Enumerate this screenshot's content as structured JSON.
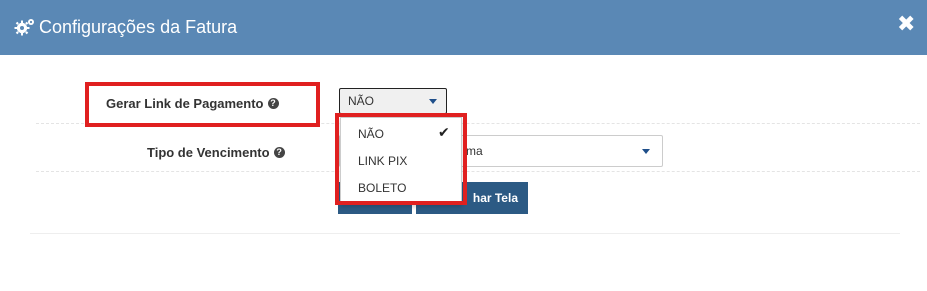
{
  "modal": {
    "title": "Configurações da Fatura",
    "close_glyph": "✖"
  },
  "form": {
    "payment_link": {
      "label": "Gerar Link de Pagamento",
      "help_glyph": "?",
      "selected": "NÃO",
      "options": [
        "NÃO",
        "LINK PIX",
        "BOLETO"
      ],
      "checkmark": "✔"
    },
    "due_type": {
      "label": "Tipo de Vencimento",
      "help_glyph": "?",
      "visible_value": "ma"
    }
  },
  "buttons": {
    "close_screen_visible": "har Tela"
  },
  "colors": {
    "header": "#5a88b5",
    "button": "#2c5a84",
    "highlight": "#e02020",
    "caret": "#1f4f8a"
  },
  "icons": [
    "gears-icon",
    "close-icon",
    "help-icon",
    "caret-down-icon",
    "checkmark-icon"
  ]
}
